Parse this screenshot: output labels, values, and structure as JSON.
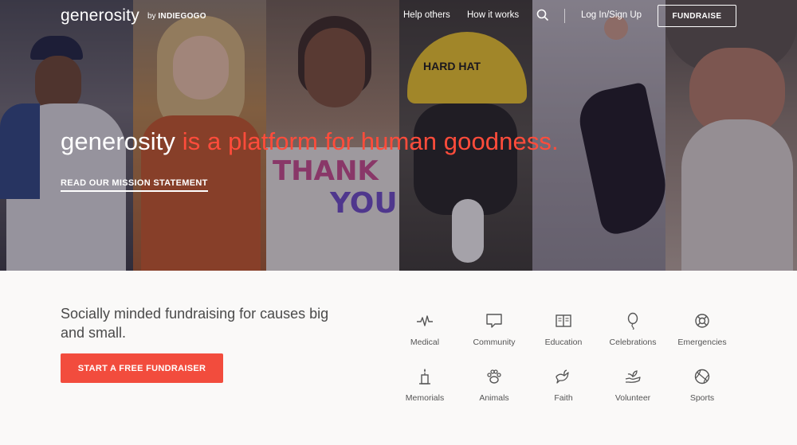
{
  "nav": {
    "logo": "generosity",
    "by_prefix": "by",
    "by_brand": "INDIEGOGO",
    "links": [
      {
        "label": "Help others"
      },
      {
        "label": "How it works"
      }
    ],
    "login": "Log In/Sign Up",
    "fundraise": "FUNDRAISE"
  },
  "hero": {
    "brand_word": "generosity",
    "headline_rest": " is a platform for human goodness.",
    "mission_link": "READ OUR MISSION STATEMENT",
    "accent_color": "#ff4c3b"
  },
  "lower": {
    "tagline": "Socially minded fundraising for causes big and small.",
    "cta": "START A FREE FUNDRAISER",
    "cta_color": "#f24c3d"
  },
  "categories": [
    {
      "label": "Medical",
      "icon": "heartbeat-icon"
    },
    {
      "label": "Community",
      "icon": "speech-bubble-icon"
    },
    {
      "label": "Education",
      "icon": "book-icon"
    },
    {
      "label": "Celebrations",
      "icon": "balloon-icon"
    },
    {
      "label": "Emergencies",
      "icon": "lifebuoy-icon"
    },
    {
      "label": "Memorials",
      "icon": "candle-icon"
    },
    {
      "label": "Animals",
      "icon": "paw-icon"
    },
    {
      "label": "Faith",
      "icon": "dove-icon"
    },
    {
      "label": "Volunteer",
      "icon": "hands-plant-icon"
    },
    {
      "label": "Sports",
      "icon": "ball-icon"
    }
  ]
}
